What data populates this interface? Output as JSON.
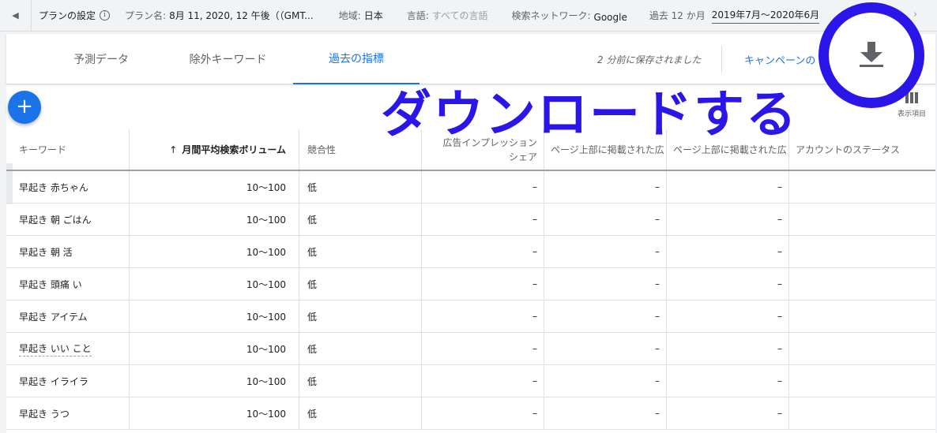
{
  "plan_bar": {
    "plan_settings_label": "プランの設定",
    "plan_name_label": "プラン名:",
    "plan_name_value": "8月 11, 2020, 12 午後（（GMT...",
    "region_label": "地域:",
    "region_value": "日本",
    "language_label": "言語:",
    "language_value": "すべての言語",
    "network_label": "検索ネットワーク:",
    "network_value": "Google",
    "period_label": "過去 12 か月",
    "date_range": "2019年7月〜2020年6月"
  },
  "tabs": [
    {
      "label": "予測データ",
      "active": false
    },
    {
      "label": "除外キーワード",
      "active": false
    },
    {
      "label": "過去の指標",
      "active": true
    }
  ],
  "saved_text": "2 分前に保存されました",
  "campaign_link": "キャンペーンの",
  "columns_label": "表示項目",
  "annotation": {
    "text": "ダウンロードする",
    "color": "#2a16e8"
  },
  "table": {
    "headers": {
      "keyword": "キーワード",
      "volume": "月間平均検索ボリューム",
      "competition": "競合性",
      "impression_share": "広告インプレッションシェア",
      "top_bid_low": "ページ上部に掲載された広",
      "top_bid_high": "ページ上部に掲載された広",
      "account_status": "アカウントのステータス"
    },
    "rows": [
      {
        "keyword": "早起き 赤ちゃん",
        "volume": "10〜100",
        "competition": "低",
        "impression_share": "–",
        "top_bid_low": "–",
        "top_bid_high": "–",
        "account_status": ""
      },
      {
        "keyword": "早起き 朝 ごはん",
        "volume": "10〜100",
        "competition": "低",
        "impression_share": "–",
        "top_bid_low": "–",
        "top_bid_high": "–",
        "account_status": ""
      },
      {
        "keyword": "早起き 朝 活",
        "volume": "10〜100",
        "competition": "低",
        "impression_share": "–",
        "top_bid_low": "–",
        "top_bid_high": "–",
        "account_status": ""
      },
      {
        "keyword": "早起き 頭痛 い",
        "volume": "10〜100",
        "competition": "低",
        "impression_share": "–",
        "top_bid_low": "–",
        "top_bid_high": "–",
        "account_status": ""
      },
      {
        "keyword": "早起き アイテム",
        "volume": "10〜100",
        "competition": "低",
        "impression_share": "–",
        "top_bid_low": "–",
        "top_bid_high": "–",
        "account_status": ""
      },
      {
        "keyword": "早起き いい こと",
        "volume": "10〜100",
        "competition": "低",
        "impression_share": "–",
        "top_bid_low": "–",
        "top_bid_high": "–",
        "account_status": ""
      },
      {
        "keyword": "早起き イライラ",
        "volume": "10〜100",
        "competition": "低",
        "impression_share": "–",
        "top_bid_low": "–",
        "top_bid_high": "–",
        "account_status": ""
      },
      {
        "keyword": "早起き うつ",
        "volume": "10〜100",
        "competition": "低",
        "impression_share": "–",
        "top_bid_low": "–",
        "top_bid_high": "–",
        "account_status": ""
      }
    ]
  }
}
